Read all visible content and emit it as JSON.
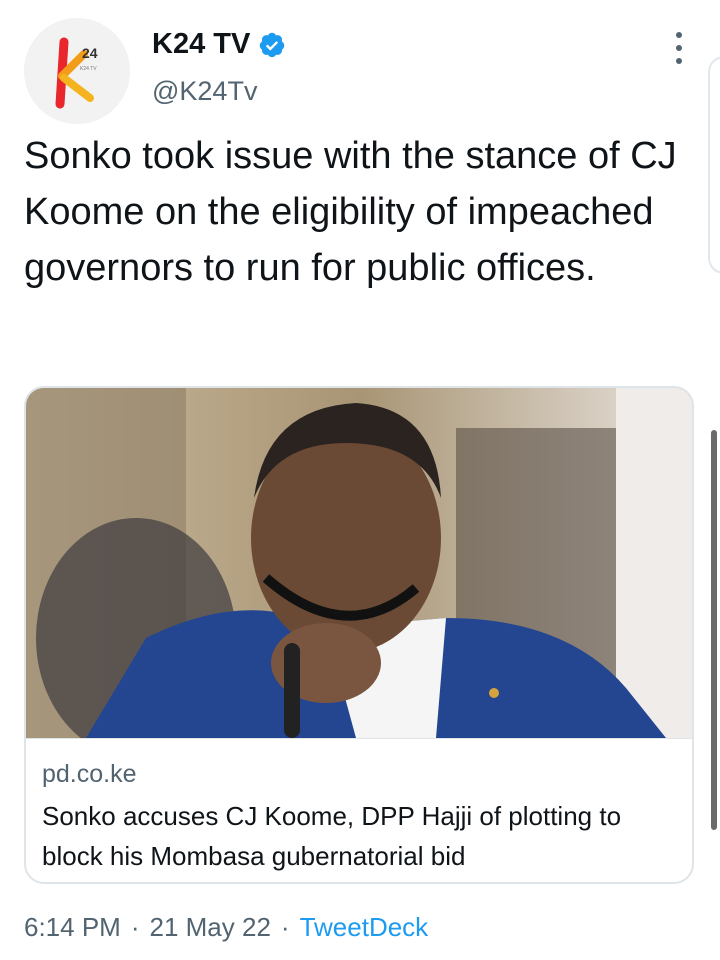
{
  "account": {
    "name": "K24 TV",
    "handle": "@K24Tv",
    "verified": true,
    "avatar_logo_text": "k24"
  },
  "tweet": {
    "text": "Sonko took issue with the stance of CJ Koome on the eligibility of impeached governors to run for public offices."
  },
  "link_card": {
    "domain": "pd.co.ke",
    "title": "Sonko accuses CJ Koome, DPP Hajji of plotting to block his Mombasa gubernatorial bid",
    "image_icon": "news-photo"
  },
  "meta": {
    "time": "6:14 PM",
    "separator": "·",
    "date": "21 May 22",
    "source": "TweetDeck"
  },
  "colors": {
    "text_primary": "#0f1419",
    "text_secondary": "#536471",
    "accent": "#1d9bf0",
    "verified_badge": "#1d9bf0",
    "card_border": "#dfe4e8"
  }
}
